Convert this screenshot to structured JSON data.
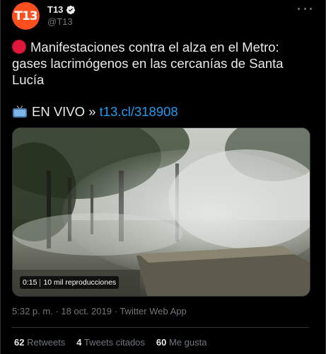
{
  "author": {
    "name": "T13",
    "handle": "@T13",
    "avatar_text": "T13",
    "avatar_color": "#ff4f1f",
    "verified": true
  },
  "tweet": {
    "line1_emoji": "red-circle-icon",
    "text": "Manifestaciones contra el alza en el Metro: gases lacrimógenos en las cercanías de Santa Lucía",
    "live_emoji": "tv-icon",
    "live_label": "EN VIVO »",
    "link_text": "t13.cl/318908"
  },
  "media": {
    "duration": "0:15",
    "views": "10 mil reproducciones"
  },
  "meta": {
    "time": "5:32 p. m.",
    "date": "18 oct. 2019",
    "app": "Twitter Web App",
    "separator": "·"
  },
  "stats": {
    "retweets_count": "62",
    "retweets_label": "Retweets",
    "quotes_count": "4",
    "quotes_label": "Tweets citados",
    "likes_count": "60",
    "likes_label": "Me gusta"
  },
  "colors": {
    "link": "#1d9bf0",
    "secondary_text": "#71767b",
    "primary_text": "#e7e9ea",
    "background": "#000000"
  }
}
